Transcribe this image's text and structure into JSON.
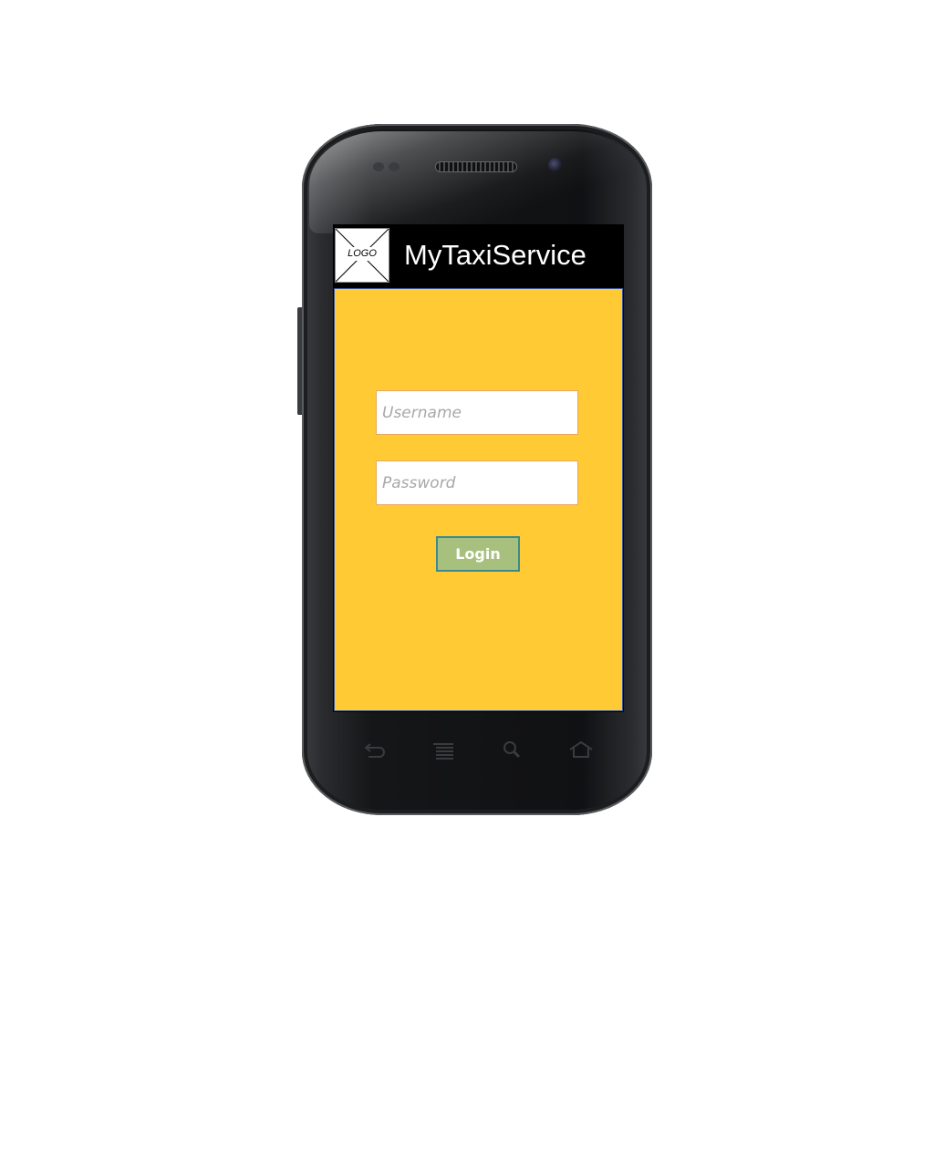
{
  "app": {
    "logo_text": "LOGO",
    "title": "MyTaxiService"
  },
  "login_form": {
    "username_placeholder": "Username",
    "password_placeholder": "Password",
    "login_label": "Login"
  },
  "nav_bar": {
    "buttons": [
      "back-icon",
      "menu-icon",
      "search-icon",
      "home-icon"
    ]
  },
  "colors": {
    "content_background": "#ffca33",
    "header_background": "#000000",
    "login_button": "#a8c07e"
  }
}
